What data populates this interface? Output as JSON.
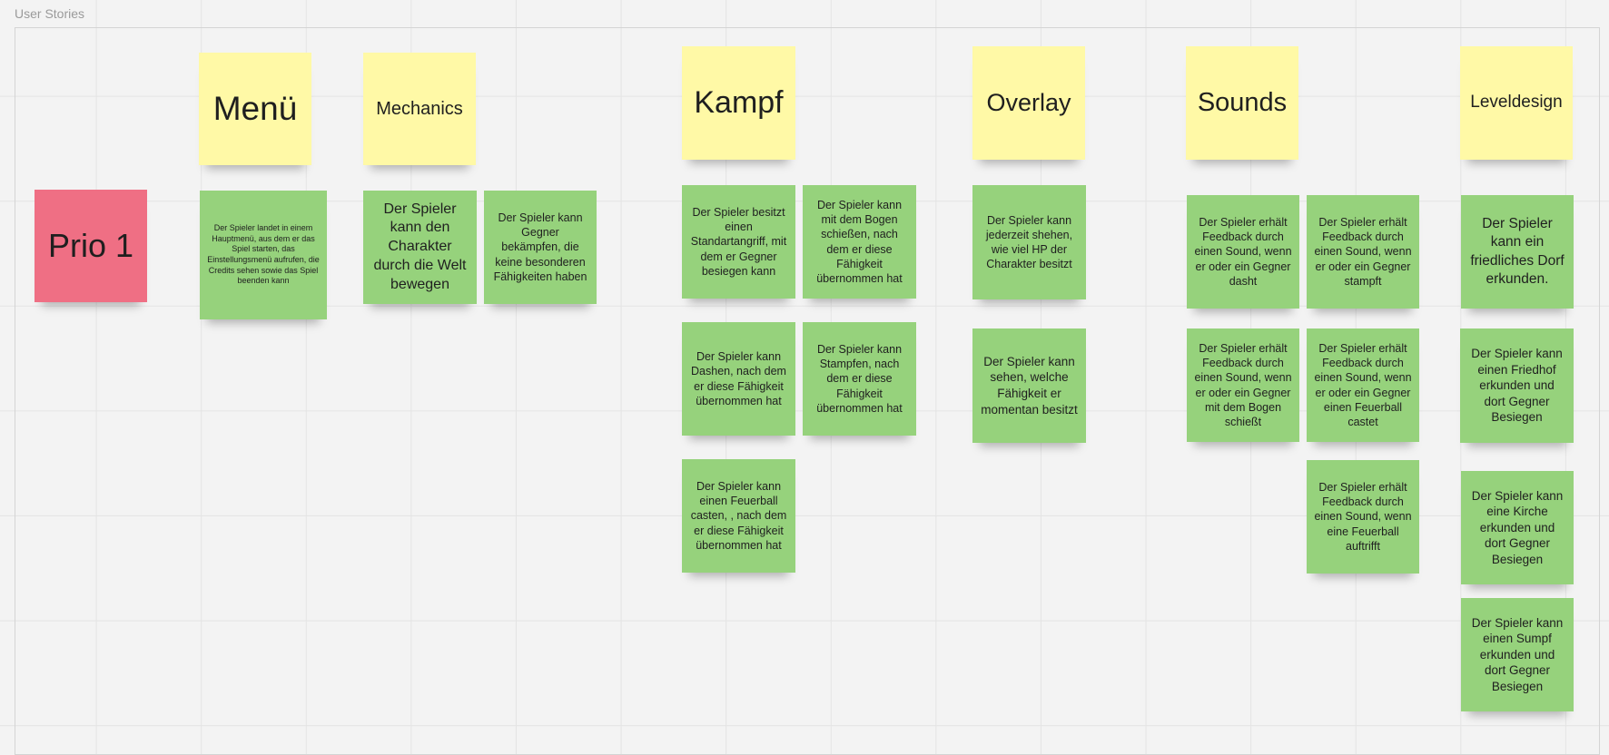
{
  "frame": {
    "title": "User Stories"
  },
  "priority": {
    "label": "Prio 1"
  },
  "columns": {
    "menu": "Menü",
    "mechanics": "Mechanics",
    "kampf": "Kampf",
    "overlay": "Overlay",
    "sounds": "Sounds",
    "leveldesign": "Leveldesign"
  },
  "stories": {
    "menu_1": "Der Spieler landet in einem Hauptmenü, aus dem er das Spiel starten, das Einstellungsmenü aufrufen, die Credits sehen sowie das Spiel beenden kann",
    "mechanics_1": "Der Spieler kann den Charakter durch die Welt bewegen",
    "mechanics_2": "Der Spieler kann Gegner bekämpfen, die keine besonderen Fähigkeiten haben",
    "kampf_1": "Der Spieler besitzt einen Standartangriff, mit dem er Gegner besiegen kann",
    "kampf_2": "Der Spieler kann mit dem Bogen schießen, nach dem er diese Fähigkeit übernommen hat",
    "kampf_3": "Der Spieler kann Dashen, nach dem er diese Fähigkeit übernommen hat",
    "kampf_4": "Der Spieler kann Stampfen, nach dem er diese Fähigkeit übernommen hat",
    "kampf_5": "Der Spieler kann einen Feuerball casten, , nach dem er diese Fähigkeit übernommen hat",
    "overlay_1": "Der Spieler kann jederzeit shehen, wie viel HP der Charakter besitzt",
    "overlay_2": "Der Spieler kann sehen, welche Fähigkeit er momentan besitzt",
    "sounds_1": "Der Spieler erhält Feedback durch einen Sound, wenn er oder ein Gegner dasht",
    "sounds_2": "Der Spieler erhält Feedback durch einen Sound, wenn er oder ein Gegner  stampft",
    "sounds_3": "Der Spieler erhält Feedback durch einen Sound, wenn er oder ein Gegner mit dem Bogen schießt",
    "sounds_4": "Der Spieler erhält Feedback durch einen Sound, wenn er oder ein Gegner einen Feuerball castet",
    "sounds_5": "Der Spieler erhält Feedback durch einen Sound, wenn eine Feuerball auftrifft",
    "level_1": "Der Spieler kann ein friedliches Dorf erkunden.",
    "level_2": "Der Spieler kann einen Friedhof erkunden und dort Gegner Besiegen",
    "level_3": "Der Spieler kann eine Kirche erkunden und dort Gegner Besiegen",
    "level_4": "Der Spieler kann einen Sumpf erkunden und dort Gegner Besiegen"
  },
  "colors": {
    "header_note": "#fff9a6",
    "story_note": "#96d27c",
    "priority_note": "#ef6f84"
  }
}
